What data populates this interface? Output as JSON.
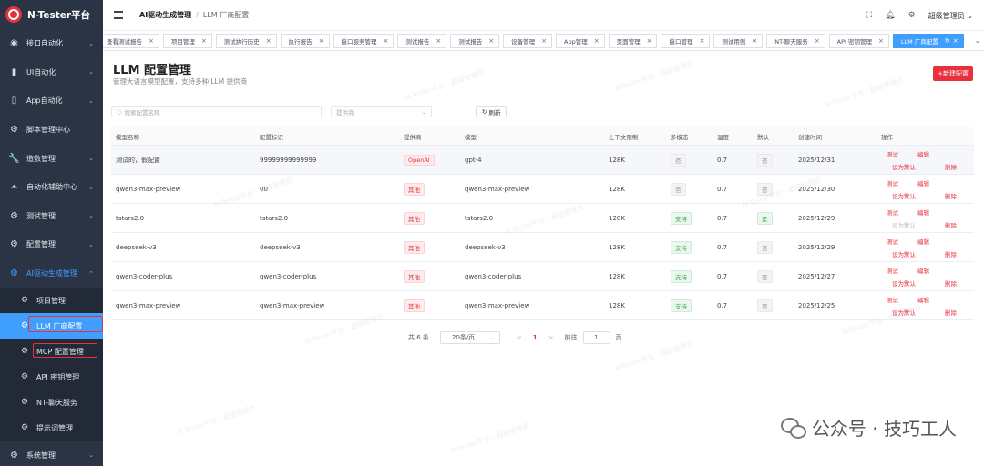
{
  "brand": {
    "title": "N-Tester平台"
  },
  "sidebar": {
    "items": [
      {
        "label": "接口自动化",
        "icon": "globe-icon"
      },
      {
        "label": "UI自动化",
        "icon": "book-icon"
      },
      {
        "label": "App自动化",
        "icon": "phone-icon"
      },
      {
        "label": "脚本管理中心",
        "icon": "gear-icon"
      },
      {
        "label": "造数管理",
        "icon": "wrench-icon"
      },
      {
        "label": "自动化辅助中心",
        "icon": "chart-icon"
      },
      {
        "label": "测试管理",
        "icon": "gear-icon"
      },
      {
        "label": "配置管理",
        "icon": "gear-icon"
      },
      {
        "label": "AI驱动生成管理",
        "icon": "gear-icon"
      }
    ],
    "subitems": [
      {
        "label": "项目管理"
      },
      {
        "label": "LLM 厂商配置"
      },
      {
        "label": "MCP 配置管理"
      },
      {
        "label": "API 密钥管理"
      },
      {
        "label": "NT-聊天服务"
      },
      {
        "label": "提示词管理"
      }
    ],
    "last": {
      "label": "系统管理"
    }
  },
  "header": {
    "crumb_parent": "AI驱动生成管理",
    "crumb_current": "LLM 厂商配置",
    "user": "超级管理员"
  },
  "tabs": [
    "查看测试报告",
    "项目管理",
    "测试执行历史",
    "执行报告",
    "接口服务管理",
    "测试报告",
    "测试报告",
    "设备管理",
    "App管理",
    "页面管理",
    "接口管理",
    "测试用例",
    "NT-聊天服务",
    "API 密钥管理",
    "LLM 厂商配置"
  ],
  "page": {
    "title": "LLM 配置管理",
    "subtitle": "管理大语言模型配置，支持多种 LLM 提供商",
    "new_button": "+新建配置",
    "search_placeholder": "搜索配置名称",
    "provider_placeholder": "提供商",
    "refresh_label": "刷新"
  },
  "table": {
    "headers": [
      "模型名称",
      "配置标识",
      "提供商",
      "模型",
      "上下文限制",
      "多模态",
      "温度",
      "默认",
      "创建时间",
      "操作"
    ],
    "rows": [
      {
        "name": "测试的，假配置",
        "key": "99999999999999",
        "provider": "OpenAI",
        "model": "gpt-4",
        "ctx": "128K",
        "multi": "否",
        "temp": "0.7",
        "default": "否",
        "created": "2025/12/31",
        "ops": [
          "测试",
          "编辑",
          "设为默认",
          "删除"
        ]
      },
      {
        "name": "qwen3-max-preview",
        "key": "00",
        "provider": "其他",
        "model": "qwen3-max-preview",
        "ctx": "128K",
        "multi": "否",
        "temp": "0.7",
        "default": "否",
        "created": "2025/12/30",
        "ops": [
          "测试",
          "编辑",
          "设为默认",
          "删除"
        ]
      },
      {
        "name": "tstars2.0",
        "key": "tstars2.0",
        "provider": "其他",
        "model": "tstars2.0",
        "ctx": "128K",
        "multi": "支持",
        "temp": "0.7",
        "default": "是",
        "created": "2025/12/29",
        "ops": [
          "测试",
          "编辑",
          "设为默认",
          "删除"
        ]
      },
      {
        "name": "deepseek-v3",
        "key": "deepseek-v3",
        "provider": "其他",
        "model": "deepseek-v3",
        "ctx": "128K",
        "multi": "支持",
        "temp": "0.7",
        "default": "否",
        "created": "2025/12/29",
        "ops": [
          "测试",
          "编辑",
          "设为默认",
          "删除"
        ]
      },
      {
        "name": "qwen3-coder-plus",
        "key": "qwen3-coder-plus",
        "provider": "其他",
        "model": "qwen3-coder-plus",
        "ctx": "128K",
        "multi": "支持",
        "temp": "0.7",
        "default": "否",
        "created": "2025/12/27",
        "ops": [
          "测试",
          "编辑",
          "设为默认",
          "删除"
        ]
      },
      {
        "name": "qwen3-max-preview",
        "key": "qwen3-max-preview",
        "provider": "其他",
        "model": "qwen3-max-preview",
        "ctx": "128K",
        "multi": "支持",
        "temp": "0.7",
        "default": "否",
        "created": "2025/12/25",
        "ops": [
          "测试",
          "编辑",
          "设为默认",
          "删除"
        ]
      }
    ]
  },
  "pager": {
    "total": "共 6 条",
    "size": "20条/页",
    "prev": "<",
    "page": "1",
    "next": ">",
    "goto": "前往",
    "goto_value": "1",
    "page_suffix": "页"
  },
  "watermark": "N-Tester平台 - 超级管理员",
  "overlay": {
    "text": "公众号 · 技巧工人"
  },
  "colors": {
    "accent": "#409eff",
    "brand": "#e8313d",
    "sidebar": "#2b3445"
  }
}
